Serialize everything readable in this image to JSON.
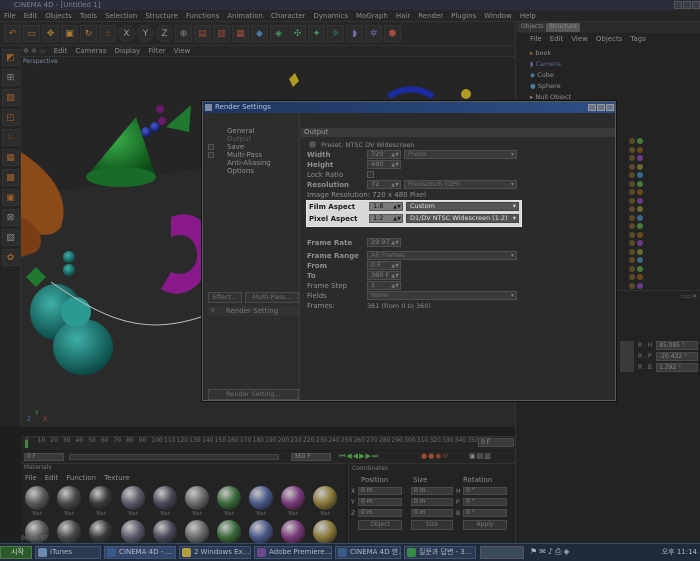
{
  "window": {
    "title": "CINEMA 4D - [Untitled 1]"
  },
  "menubar": [
    "File",
    "Edit",
    "Objects",
    "Tools",
    "Selection",
    "Structure",
    "Functions",
    "Animation",
    "Character",
    "Dynamics",
    "MoGraph",
    "Hair",
    "Render",
    "Plugins",
    "Window",
    "Help"
  ],
  "viewport": {
    "menu": [
      "Edit",
      "Cameras",
      "Display",
      "Filter",
      "View"
    ],
    "label": "Perspective"
  },
  "timeline": {
    "ticks": [
      "0",
      "10",
      "20",
      "30",
      "40",
      "50",
      "60",
      "70",
      "80",
      "90",
      "100",
      "110",
      "120",
      "130",
      "140",
      "150",
      "160",
      "170",
      "180",
      "190",
      "200",
      "210",
      "220",
      "230",
      "240",
      "250",
      "260",
      "270",
      "280",
      "290",
      "300",
      "310",
      "320",
      "330",
      "340",
      "350",
      "360"
    ],
    "current_frame": "0 F",
    "start_field": "0 F",
    "end_field": "360 F"
  },
  "materials": {
    "title": "Materials",
    "menu": [
      "File",
      "Edit",
      "Function",
      "Texture"
    ],
    "labels": [
      "Mat",
      "Mat",
      "Mat",
      "Mat",
      "Mat",
      "Mat",
      "Mat",
      "Mat",
      "Mat",
      "Mat"
    ]
  },
  "coordinates": {
    "title": "Coordinates",
    "headers": [
      "Position",
      "Size",
      "Rotation"
    ],
    "rows": [
      {
        "axis": "X",
        "pos": "0 m",
        "size": "0 m",
        "rot_label": "H",
        "rot": "0 °"
      },
      {
        "axis": "Y",
        "pos": "0 m",
        "size": "0 m",
        "rot_label": "P",
        "rot": "0 °"
      },
      {
        "axis": "Z",
        "pos": "0 m",
        "size": "0 m",
        "rot_label": "B",
        "rot": "0 °"
      }
    ],
    "mode_dropdown": "Object",
    "size_dropdown": "Size",
    "apply_label": "Apply"
  },
  "objects": {
    "tabs": [
      "Objects",
      "Structure"
    ],
    "menu": [
      "File",
      "Edit",
      "View",
      "Objects",
      "Tags"
    ],
    "items": [
      "book",
      "Camera",
      "Cube",
      "Sphere",
      "Null Object"
    ]
  },
  "attributes": {
    "rows": [
      {
        "label": "R . H",
        "value": "45.095 °"
      },
      {
        "label": "R . P",
        "value": "-20.432 °"
      },
      {
        "label": "R . B",
        "value": "1.292 °"
      }
    ]
  },
  "dialog": {
    "title": "Render Settings",
    "nav": [
      "General",
      "Output",
      "Save",
      "Multi-Pass",
      "Anti-Aliasing",
      "Options"
    ],
    "effect_button": "Effect...",
    "multipass_button": "Multi-Pass...",
    "render_setting_item": "Render Setting",
    "render_setting_button": "Render Setting...",
    "section": "Output",
    "preset": "Preset: NTSC DV Widescreen",
    "width": {
      "label": "Width",
      "value": "720",
      "unit": "Pixels"
    },
    "height": {
      "label": "Height",
      "value": "480"
    },
    "lock_ratio": "Lock Ratio",
    "resolution": {
      "label": "Resolution",
      "value": "72",
      "unit": "Pixels/Inch (DPI)"
    },
    "image_resolution": "Image Resolution: 720 x 480 Pixel",
    "film_aspect": {
      "label": "Film Aspect",
      "value": "1.8",
      "option": "Custom"
    },
    "pixel_aspect": {
      "label": "Pixel Aspect",
      "value": "1.2",
      "option": "D1/DV NTSC Widescreen (1.2)"
    },
    "frame_rate": {
      "label": "Frame Rate",
      "value": "29.97"
    },
    "frame_range": {
      "label": "Frame Range",
      "option": "All Frames"
    },
    "from": {
      "label": "From",
      "value": "0 F"
    },
    "to": {
      "label": "To",
      "value": "360 F"
    },
    "frame_step": {
      "label": "Frame Step",
      "value": "1"
    },
    "fields": {
      "label": "Fields",
      "option": "None"
    },
    "frames": "Frames:",
    "frames_value": "361 (from 0 to 360)"
  },
  "status": {
    "time": "00:00:07"
  },
  "taskbar": {
    "start": "시작",
    "tasks": [
      "iTunes",
      "CINEMA 4D - ...",
      "2 Windows Ex...",
      "Adobe Premiere...",
      "CINEMA 4D 한...",
      "질문과 답변 - 3..."
    ],
    "clock": "오후 11:14"
  },
  "colors": {
    "dialog_title": "#2d4f86",
    "highlight": "#d8d8d8",
    "taskbar": "#1f2a3a"
  }
}
